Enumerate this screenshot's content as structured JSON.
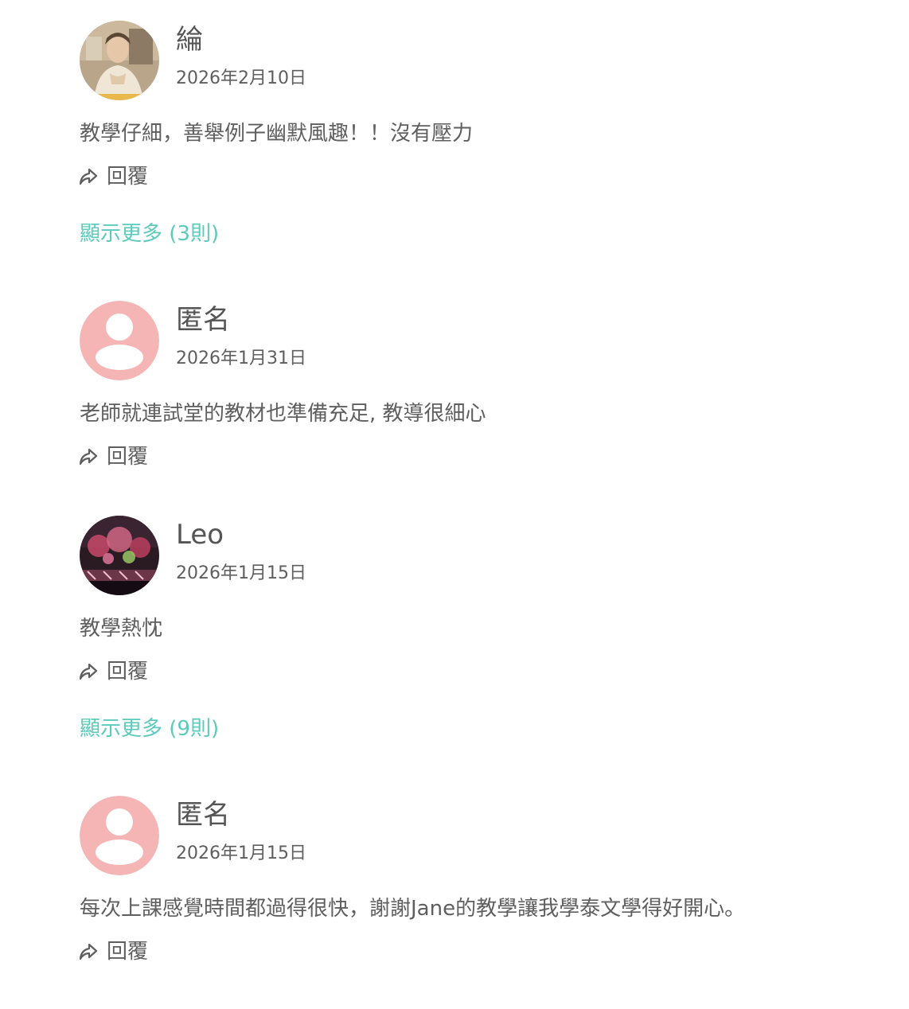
{
  "reviews": [
    {
      "name": "綸",
      "date": "2026年2月10日",
      "comment": "教學仔細，善舉例子幽默風趣！！沒有壓力",
      "reply_label": "回覆",
      "show_more": "顯示更多 (3則)"
    },
    {
      "name": "匿名",
      "date": "2026年1月31日",
      "comment": "老師就連試堂的教材也準備充足, 教導很細心",
      "reply_label": "回覆"
    },
    {
      "name": "Leo",
      "date": "2026年1月15日",
      "comment": "教學熱忱",
      "reply_label": "回覆",
      "show_more": "顯示更多 (9則)"
    },
    {
      "name": "匿名",
      "date": "2026年1月15日",
      "comment": "每次上課感覺時間都過得很快，謝謝Jane的教學讓我學泰文學得好開心。",
      "reply_label": "回覆"
    }
  ],
  "colors": {
    "accent": "#5ccbbb",
    "anonymous_avatar": "#f5b5b5",
    "text": "#5f5f5f"
  },
  "icons": {
    "reply": "reply-arrow-icon",
    "anonymous_avatar": "person-silhouette-icon"
  }
}
